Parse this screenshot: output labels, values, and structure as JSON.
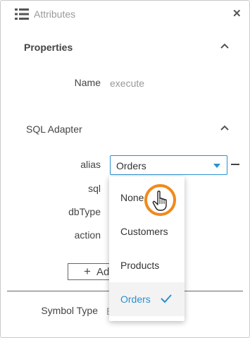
{
  "header": {
    "title": "Attributes"
  },
  "properties": {
    "heading": "Properties",
    "name_label": "Name",
    "name_value": "execute"
  },
  "sql_adapter": {
    "heading": "SQL Adapter",
    "alias_label": "alias",
    "alias_value": "Orders",
    "sql_label": "sql",
    "dbtype_label": "dbType",
    "action_label": "action",
    "add_label": "Ad"
  },
  "footer": {
    "symbol_type_label": "Symbol Type",
    "symbol_type_value": "E"
  },
  "dropdown": {
    "options": [
      "None",
      "Customers",
      "Products",
      "Orders"
    ],
    "selected": "Orders"
  },
  "colors": {
    "accent": "#2b8fd1",
    "highlight_ring": "#f08a1c"
  }
}
